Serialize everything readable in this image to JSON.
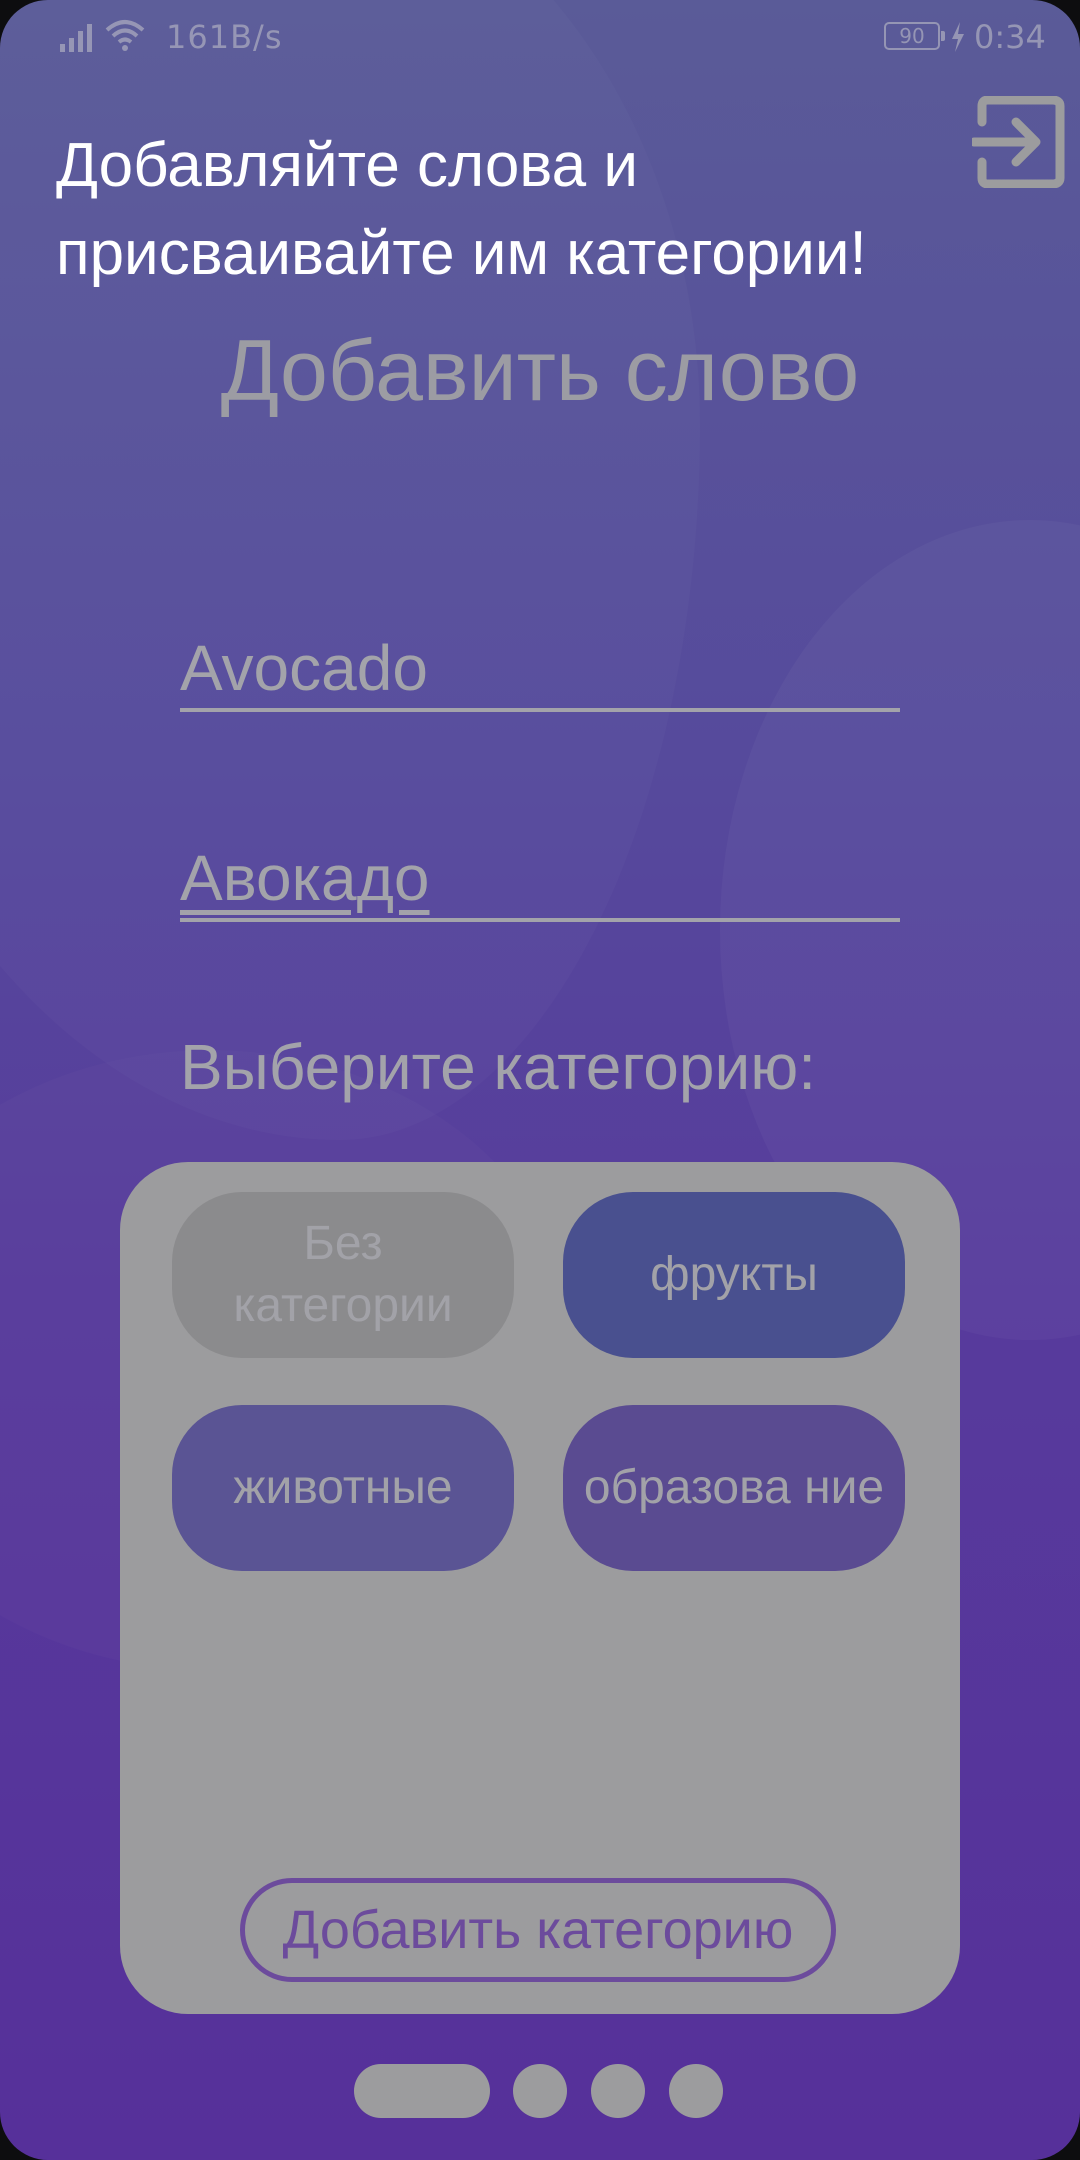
{
  "status_bar": {
    "net_speed": "161B/s",
    "battery": "90",
    "time": "0:34",
    "icons": [
      "signal-icon",
      "wifi-icon",
      "battery-icon",
      "charging-icon"
    ]
  },
  "header": {
    "title": "Добавляйте слова и присваивайте им категории!",
    "exit_icon": "exit-icon"
  },
  "form": {
    "section_title": "Добавить слово",
    "word_value": "Avocado",
    "translation_value": "Авокадо",
    "choose_label": "Выберите категорию:"
  },
  "categories": [
    {
      "label": "Без категории",
      "selected": false
    },
    {
      "label": "фрукты",
      "selected": true
    },
    {
      "label": "животные",
      "selected": false
    },
    {
      "label": "образование",
      "selected": false
    }
  ],
  "category_labels_display": {
    "c0": "Без категории",
    "c1": "фрукты",
    "c2": "животные",
    "c3": "образова ние"
  },
  "add_category_label": "Добавить категорию",
  "pager": {
    "pages": 4,
    "current": 1
  },
  "colors": {
    "background_top": "#5a5b98",
    "background_bottom": "#56309a",
    "panel": "#9c9c9e",
    "chip_selected": "#49508f",
    "accent_outline": "#6c4b9c"
  }
}
